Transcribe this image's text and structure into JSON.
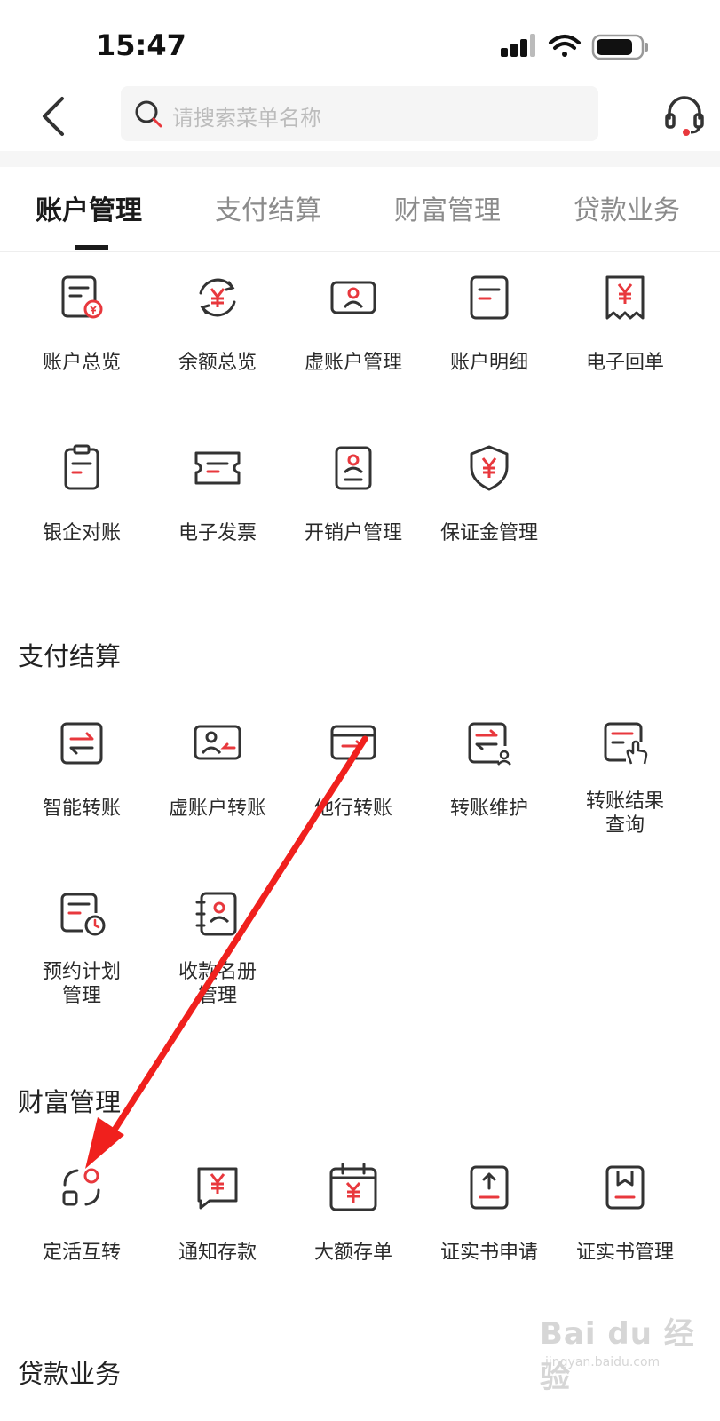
{
  "status_bar": {
    "time": "15:47"
  },
  "search": {
    "placeholder": "请搜索菜单名称"
  },
  "tabs": [
    {
      "label": "账户管理",
      "active": true
    },
    {
      "label": "支付结算",
      "active": false
    },
    {
      "label": "财富管理",
      "active": false
    },
    {
      "label": "贷款业务",
      "active": false
    }
  ],
  "sections": {
    "account": {
      "items": [
        {
          "label": "账户总览",
          "icon": "account-overview-icon"
        },
        {
          "label": "余额总览",
          "icon": "balance-overview-icon"
        },
        {
          "label": "虚账户管理",
          "icon": "virtual-account-icon"
        },
        {
          "label": "账户明细",
          "icon": "account-detail-icon"
        },
        {
          "label": "电子回单",
          "icon": "receipt-icon"
        },
        {
          "label": "银企对账",
          "icon": "clipboard-icon"
        },
        {
          "label": "电子发票",
          "icon": "invoice-ticket-icon"
        },
        {
          "label": "开销户管理",
          "icon": "account-open-icon"
        },
        {
          "label": "保证金管理",
          "icon": "shield-yuan-icon"
        }
      ]
    },
    "payment": {
      "title": "支付结算",
      "items": [
        {
          "label": "智能转账",
          "icon": "transfer-icon"
        },
        {
          "label": "虚账户转账",
          "icon": "virtual-transfer-icon"
        },
        {
          "label": "他行转账",
          "icon": "card-transfer-icon"
        },
        {
          "label": "转账维护",
          "icon": "transfer-maintain-icon"
        },
        {
          "label_line1": "转账结果",
          "label_line2": "查询",
          "icon": "transfer-query-icon"
        },
        {
          "label_line1": "预约计划",
          "label_line2": "管理",
          "icon": "schedule-plan-icon"
        },
        {
          "label_line1": "收款名册",
          "label_line2": "管理",
          "icon": "payee-book-icon"
        }
      ]
    },
    "wealth": {
      "title": "财富管理",
      "items": [
        {
          "label": "定活互转",
          "icon": "swap-deposit-icon"
        },
        {
          "label": "通知存款",
          "icon": "notice-deposit-icon"
        },
        {
          "label": "大额存单",
          "icon": "calendar-yuan-icon"
        },
        {
          "label": "证实书申请",
          "icon": "certificate-apply-icon"
        },
        {
          "label": "证实书管理",
          "icon": "certificate-manage-icon"
        }
      ]
    },
    "loan": {
      "title": "贷款业务"
    }
  },
  "watermark": {
    "brand": "Bai du 经验",
    "url": "jingyan.baidu.com"
  },
  "colors": {
    "accent": "#e8383d",
    "icon_stroke": "#333333",
    "annotation_arrow": "#f0201d"
  }
}
